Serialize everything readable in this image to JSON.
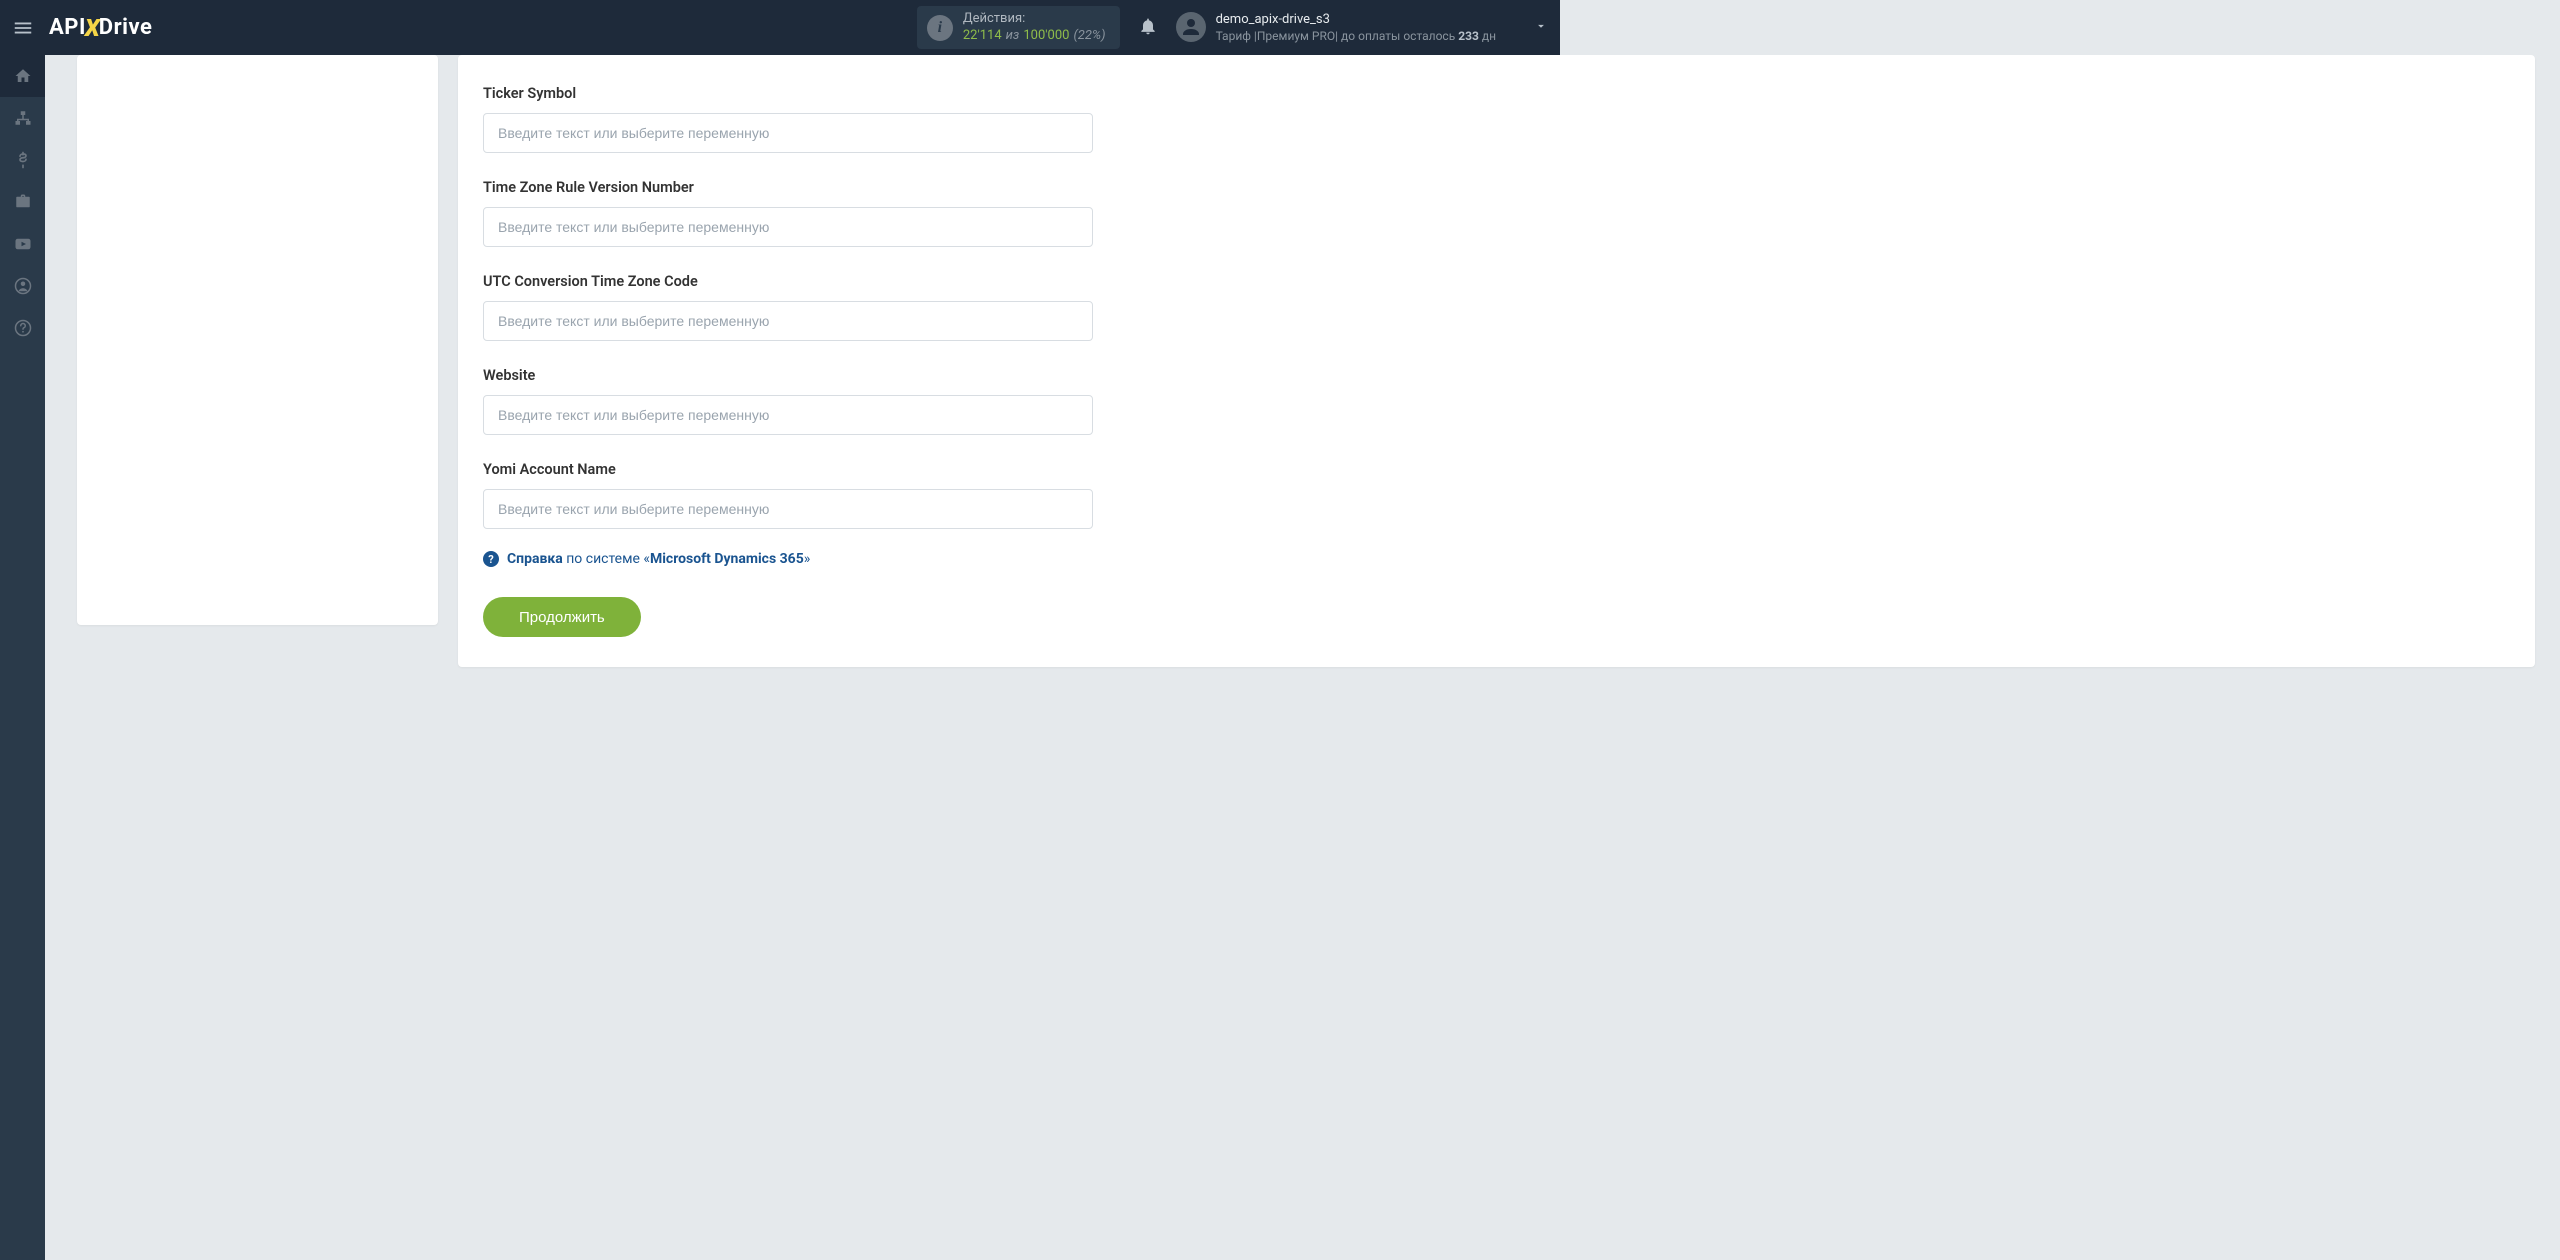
{
  "logo": {
    "part1": "API",
    "part2": "X",
    "part3": "Drive"
  },
  "header": {
    "actions_label": "Действия:",
    "actions_count": "22'114",
    "actions_iz": "из",
    "actions_total": "100'000",
    "actions_pct": "(22%)",
    "user_name": "demo_apix-drive_s3",
    "tariff_prefix": "Тариф |",
    "tariff_name": "Премиум PRO",
    "tariff_sep": "| до оплаты осталось ",
    "tariff_days": "233",
    "tariff_unit": " дн"
  },
  "form": {
    "fields": [
      {
        "label": "Ticker Symbol"
      },
      {
        "label": "Time Zone Rule Version Number"
      },
      {
        "label": "UTC Conversion Time Zone Code"
      },
      {
        "label": "Website"
      },
      {
        "label": "Yomi Account Name"
      }
    ],
    "placeholder": "Введите текст или выберите переменную",
    "help_label": "Справка",
    "help_mid": " по системе «",
    "help_system": "Microsoft Dynamics 365",
    "help_end": "»",
    "continue": "Продолжить"
  }
}
